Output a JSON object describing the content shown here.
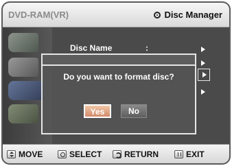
{
  "header": {
    "mode_label": "DVD-RAM(VR)",
    "menu_title": "Disc Manager"
  },
  "sidebar": {
    "icons": [
      "disc-manager-icon",
      "programme-icon",
      "disc-navigation-icon",
      "setup-icon"
    ]
  },
  "disc_manager": {
    "disc_name_label": "Disc Name",
    "disc_name_separator": ":"
  },
  "dialog": {
    "message": "Do you want to format disc?",
    "yes_label": "Yes",
    "no_label": "No",
    "selected": "Yes"
  },
  "footer": {
    "move_label": "MOVE",
    "select_label": "SELECT",
    "return_label": "RETURN",
    "exit_label": "EXIT"
  },
  "colors": {
    "header_bg": "#e8e8e8",
    "content_bg": "#4a4a4a",
    "dialog_border": "#e6e6e6",
    "selected_button": "#e0a584",
    "footer_bg": "#e6e6e6"
  }
}
